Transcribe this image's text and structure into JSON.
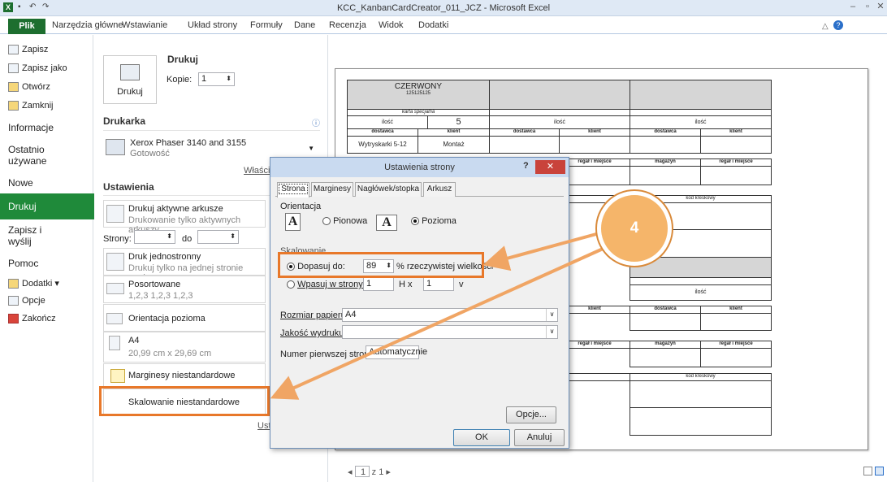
{
  "window": {
    "title": "KCC_KanbanCardCreator_011_JCZ - Microsoft Excel"
  },
  "ribbon": {
    "tabs": [
      "Plik",
      "Narzędzia główne",
      "Wstawianie",
      "Układ strony",
      "Formuły",
      "Dane",
      "Recenzja",
      "Widok",
      "Dodatki"
    ]
  },
  "nav": {
    "items": [
      "Zapisz",
      "Zapisz jako",
      "Otwórz",
      "Zamknij",
      "Informacje",
      "Ostatnio używane",
      "Nowe",
      "Drukuj",
      "Zapisz i wyślij",
      "Pomoc",
      "Dodatki",
      "Opcje",
      "Zakończ"
    ],
    "recent_line1": "Ostatnio",
    "recent_line2": "używane",
    "send_line1": "Zapisz i",
    "send_line2": "wyślij",
    "addins": "Dodatki ▾"
  },
  "print": {
    "title": "Drukuj",
    "copies_label": "Kopie:",
    "copies_value": "1",
    "print_button": "Drukuj",
    "printer_section": "Drukarka",
    "printer_name": "Xerox Phaser 3140 and 3155",
    "printer_status": "Gotowość",
    "printer_props": "Właściw",
    "settings_section": "Ustawienia",
    "opt1_title": "Drukuj aktywne arkusze",
    "opt1_sub": "Drukowanie tylko aktywnych arkuszy",
    "pages_label": "Strony:",
    "pages_to": "do",
    "opt2_title": "Druk jednostronny",
    "opt2_sub": "Drukuj tylko na jednej stronie papieru",
    "opt3_title": "Posortowane",
    "opt3_sub": "1,2,3   1,2,3   1,2,3",
    "opt4_title": "Orientacja pozioma",
    "opt5_title": "A4",
    "opt5_sub": "20,99 cm x 29,69 cm",
    "opt6_title": "Marginesy niestandardowe",
    "opt7_title": "Skalowanie niestandardowe",
    "setup_link": "Ust"
  },
  "card": {
    "color": "CZERWONY",
    "code": "125125125",
    "subtitle": "karta specjalna",
    "qty_label": "ilość",
    "qty_value": "5",
    "supplier": "dostawca",
    "client": "klient",
    "supplier_value": "Wytryskarki 5-12",
    "client_value": "Montaż",
    "rack": "regał i miejsce",
    "warehouse": "magazyn",
    "barcode": "kod kreskowy",
    "barcode_partial": "wy"
  },
  "dialog": {
    "title": "Ustawienia strony",
    "help": "?",
    "close": "✕",
    "tabs": [
      "Strona",
      "Marginesy",
      "Nagłówek/stopka",
      "Arkusz"
    ],
    "orientation_label": "Orientacja",
    "portrait": "Pionowa",
    "landscape": "Pozioma",
    "scaling_label": "Skalowanie",
    "fit_label": "Dopasuj do:",
    "fit_value": "89",
    "fit_suffix": "% rzeczywistej wielkości",
    "fit2_label": "Wpasuj w strony:",
    "fit2_w": "1",
    "fit2_x": "H  x",
    "fit2_h": "1",
    "fit2_v": "v",
    "paper_label": "Rozmiar papieru:",
    "paper_value": "A4",
    "quality_label": "Jakość wydruku:",
    "quality_value": "",
    "first_page_label": "Numer pierwszej strony:",
    "first_page_value": "Automatycznie",
    "options_button": "Opcje...",
    "ok_button": "OK",
    "cancel_button": "Anuluj"
  },
  "annotation": {
    "step": "4",
    "color": "#e8782a"
  },
  "pager": {
    "current": "1",
    "total": "z 1"
  }
}
